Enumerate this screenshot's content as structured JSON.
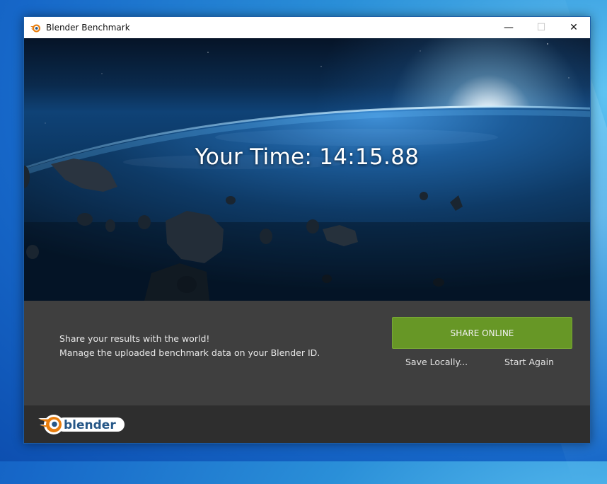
{
  "window": {
    "title": "Blender Benchmark",
    "controls": {
      "minimize": "—",
      "maximize": "☐",
      "close": "✕"
    }
  },
  "hero": {
    "time_text": "Your Time: 14:15.88"
  },
  "panel": {
    "line1": "Share your results with the world!",
    "line2": "Manage the uploaded benchmark data on your Blender ID.",
    "share_button": "SHARE ONLINE",
    "save_button": "Save Locally...",
    "restart_button": "Start Again"
  },
  "footer": {
    "logo_text": "blender"
  },
  "colors": {
    "accent_green": "#679726",
    "panel_bg": "#3f3f3f",
    "footer_bg": "#2e2e2e",
    "logo_orange": "#e87d0d",
    "logo_blue": "#265787"
  },
  "icons": {
    "app_icon": "blender-icon",
    "minimize": "minimize-icon",
    "maximize": "maximize-icon",
    "close": "close-icon"
  }
}
